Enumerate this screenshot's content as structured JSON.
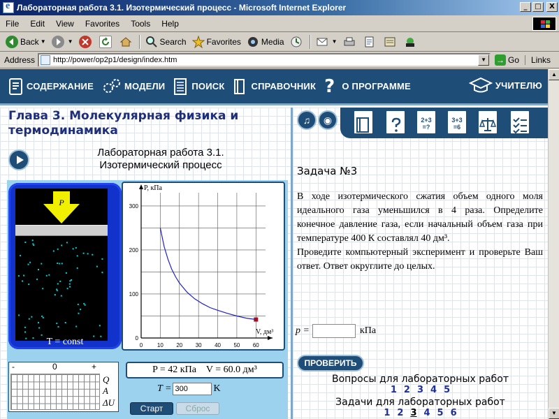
{
  "window": {
    "title": "Лабораторная работа 3.1. Изотермический процесс - Microsoft Internet Explorer",
    "minimize": "_",
    "maximize": "□",
    "close": "X"
  },
  "menu": [
    "File",
    "Edit",
    "View",
    "Favorites",
    "Tools",
    "Help"
  ],
  "toolbar": {
    "back": "Back",
    "search": "Search",
    "favorites": "Favorites",
    "media": "Media"
  },
  "address": {
    "label": "Address",
    "url": "http://power/op2p1/design/index.htm",
    "go": "Go",
    "links": "Links"
  },
  "nav": {
    "contents": "СОДЕРЖАНИЕ",
    "models": "МОДЕЛИ",
    "search": "ПОИСК",
    "reference": "СПРАВОЧНИК",
    "help_mark": "?",
    "about": "О ПРОГРАММЕ",
    "teacher": "УЧИТЕЛЮ"
  },
  "chapter_title": "Глава 3. Молекулярная физика и термодинамика",
  "lab": {
    "title_line1": "Лабораторная работа 3.1.",
    "title_line2": "Изотермический процесс"
  },
  "simulation": {
    "piston_label": "P",
    "t_const": "T = const",
    "heat_minus": "-",
    "heat_zero": "0",
    "heat_plus": "+",
    "heat_q": "Q",
    "heat_a": "A",
    "heat_du": "ΔU",
    "p_readout": "P = 42 кПа",
    "v_readout": "V = 60.0 дм³",
    "t_label": "T =",
    "t_value": "300",
    "t_unit": "K",
    "start": "Старт",
    "reset": "Сброс"
  },
  "chart_data": {
    "type": "line",
    "ylabel": "P, кПа",
    "xlabel": "V, дм³",
    "xlim": [
      0,
      65
    ],
    "ylim": [
      0,
      330
    ],
    "xticks": [
      0,
      10,
      20,
      30,
      40,
      50,
      60
    ],
    "yticks": [
      0,
      100,
      200,
      300
    ],
    "grid": true,
    "series": [
      {
        "color": "#2020cc",
        "x": [
          10,
          12,
          14,
          16,
          18,
          20,
          24,
          28,
          32,
          36,
          40,
          45,
          50,
          55,
          60
        ],
        "y": [
          250,
          208,
          179,
          156,
          139,
          125,
          104,
          89,
          78,
          69,
          63,
          56,
          50,
          45,
          42
        ]
      }
    ],
    "current_point": {
      "x": 60,
      "y": 42,
      "color": "#a01020"
    }
  },
  "right": {
    "icons": [
      "♫",
      "◉"
    ],
    "task_title": "Задача №3",
    "task_para1": "В ходе изотермического сжатия объем одного моля идеального газа уменьшился в 4 раза. Определите конечное давление газа, если начальный объем газа при температуре 400 К составлял 40 дм³.",
    "task_para2": "Проведите компьютерный эксперимент и проверьте Ваш ответ. Ответ округлите до целых.",
    "answer_var": "p =",
    "answer_unit": "кПа",
    "check": "ПРОВЕРИТЬ",
    "questions_head": "Вопросы для лабораторных работ",
    "questions": [
      "1",
      "2",
      "3",
      "4",
      "5"
    ],
    "tasks_head": "Задачи для лабораторных работ",
    "tasks": [
      "1",
      "2",
      "3",
      "4",
      "5",
      "6"
    ]
  }
}
